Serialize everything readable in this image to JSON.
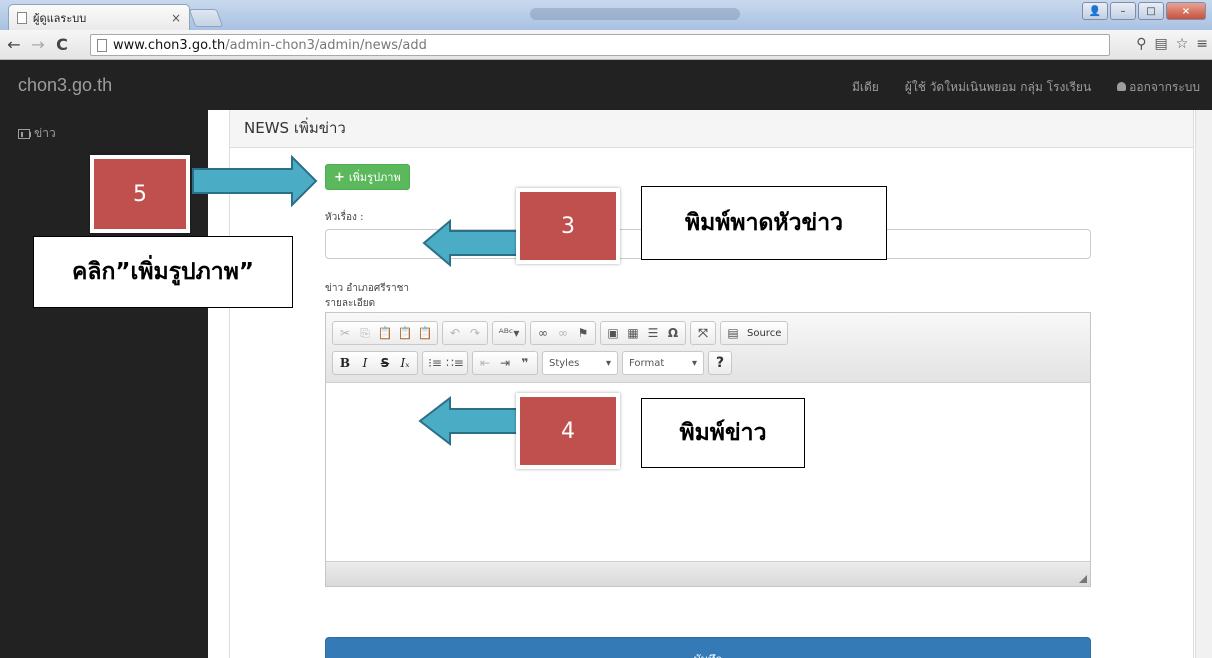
{
  "browser": {
    "tab_title": "ผู้ดูแลระบบ",
    "tab_close": "×",
    "url_host": "www.chon3.go.th",
    "url_path": "/admin-chon3/admin/news/add"
  },
  "navbar": {
    "brand": "chon3.go.th",
    "items": [
      {
        "label": "มีเดีย"
      },
      {
        "label": "ผู้ใช้ วัดใหม่เนินพยอม กลุ่ม โรงเรียน"
      },
      {
        "label": "ออกจากระบบ"
      }
    ]
  },
  "sidebar": {
    "items": [
      {
        "label": "ข่าว"
      }
    ]
  },
  "page": {
    "title": "NEWS เพิ่มข่าว",
    "add_image_label": "เพิ่มรูปภาพ",
    "headline_label": "หัวเรื่อง :",
    "news_label": "ข่าว อำเภอศรีราชา",
    "detail_label": "รายละเอียด",
    "save_label": "บันทึก"
  },
  "editor": {
    "source_label": "Source",
    "styles_label": "Styles",
    "format_label": "Format",
    "help_label": "?"
  },
  "annotations": {
    "step5": "5",
    "step5_text": "คลิก”เพิ่มรูปภาพ”",
    "step3": "3",
    "step3_text": "พิมพ์พาดหัวข่าว",
    "step4": "4",
    "step4_text": "พิมพ์ข่าว"
  },
  "colors": {
    "navbar_bg": "#222222",
    "add_button": "#5cb85c",
    "save_button": "#337ab7",
    "annotation_box": "#c0504d",
    "annotation_arrow": "#4bacc6"
  }
}
